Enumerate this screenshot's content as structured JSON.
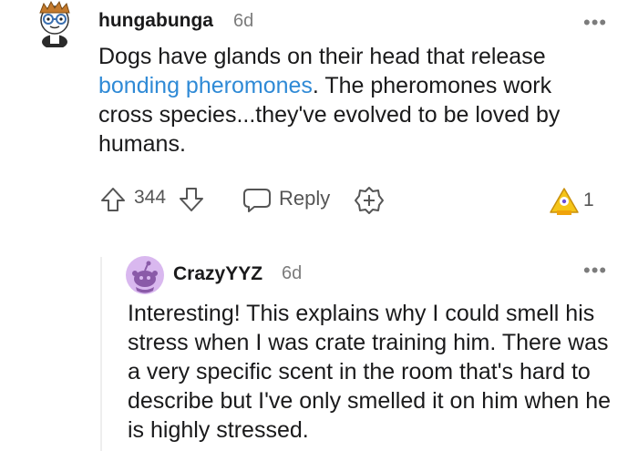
{
  "comment": {
    "username": "hungabunga",
    "age": "6d",
    "more": "•••",
    "body_before_link": "Dogs have glands on their head that release ",
    "link_text": "bonding pheromones",
    "body_after_link": ". The pheromones work cross species...they've evolved to be loved by humans.",
    "score": "344",
    "reply_label": "Reply",
    "award_count": "1",
    "icons": {
      "avatar": "snoo-avatar-glasses",
      "upvote": "arrow-up-icon",
      "downvote": "arrow-down-icon",
      "reply": "chat-bubble-icon",
      "give_award": "plus-badge-icon",
      "award": "award-icon"
    }
  },
  "reply": {
    "username": "CrazyYYZ",
    "age": "6d",
    "more": "•••",
    "body": "Interesting! This explains why I could smell his stress when I was crate training him. There was a very specific scent in the room that's hard to describe but I've only smelled it on him when he is highly stressed.",
    "icons": {
      "avatar": "default-snoo-avatar"
    }
  },
  "colors": {
    "link": "#2f8ad6",
    "meta": "#7c7c7c",
    "avatar_bg": "#d9b8ef",
    "award": "#f5c518"
  }
}
